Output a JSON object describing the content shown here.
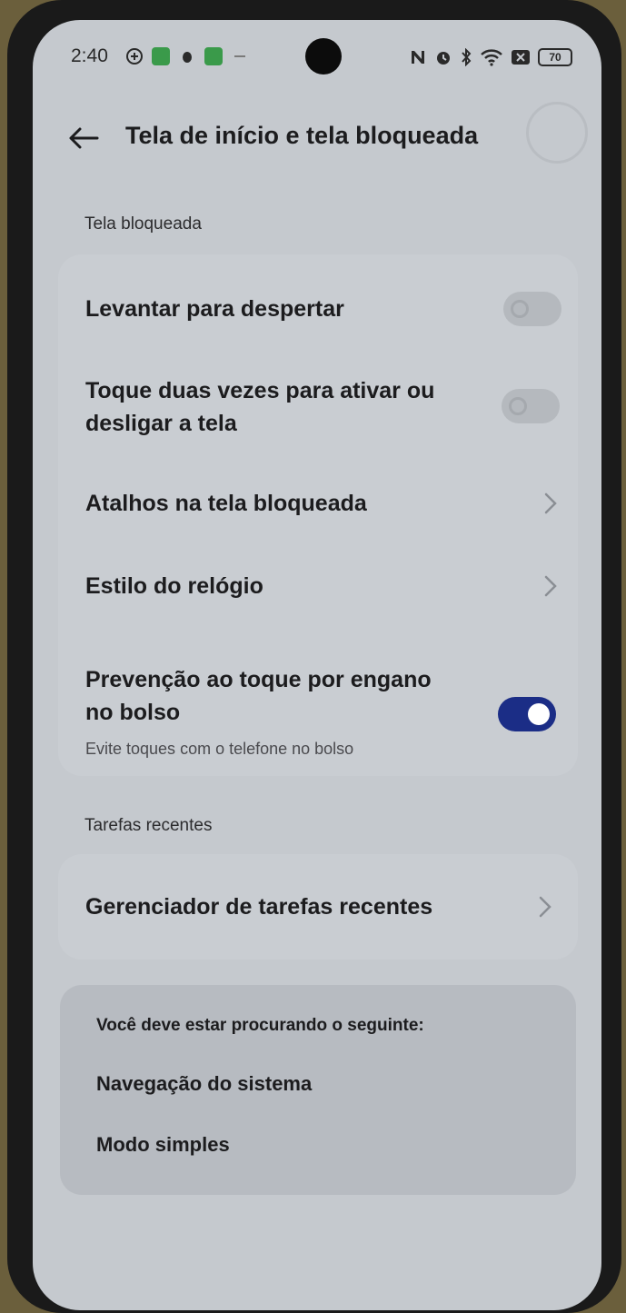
{
  "status_bar": {
    "time": "2:40",
    "battery": "70",
    "left_icons": [
      "vpn-icon",
      "app-notification-icon",
      "bug-icon",
      "app-notification-icon",
      "dots-icon"
    ],
    "right_icons": [
      "nfc-icon",
      "alarm-icon",
      "bluetooth-icon",
      "wifi-icon",
      "no-sim-icon",
      "battery-icon"
    ]
  },
  "header": {
    "title": "Tela de início e tela bloqueada",
    "back_icon": "arrow-left-icon"
  },
  "lock_screen": {
    "section_label": "Tela bloqueada",
    "items": [
      {
        "title": "Levantar para despertar",
        "control": "toggle",
        "on": false
      },
      {
        "title": "Toque duas vezes para ativar ou desligar a tela",
        "line1": "Toque duas vezes para ativar ou",
        "line2": "desligar a tela",
        "control": "toggle",
        "on": false
      },
      {
        "title": "Atalhos na tela bloqueada",
        "control": "chevron"
      },
      {
        "title": "Estilo do relógio",
        "control": "chevron"
      },
      {
        "title": "Prevenção ao toque por engano no bolso",
        "line1": "Prevenção ao toque por engano",
        "line2": "no bolso",
        "subtitle": "Evite toques com o telefone no bolso",
        "control": "toggle",
        "on": true
      }
    ]
  },
  "recent_tasks": {
    "section_label": "Tarefas recentes",
    "items": [
      {
        "title": "Gerenciador de tarefas recentes",
        "control": "chevron"
      }
    ]
  },
  "suggestions": {
    "heading": "Você deve estar procurando o seguinte:",
    "items": [
      "Navegação do sistema",
      "Modo simples"
    ]
  },
  "colors": {
    "screen_bg": "#c5c9ce",
    "card_bg": "#c9cdd2",
    "toggle_on": "#1b2d86",
    "toggle_off": "#b5b9be"
  }
}
